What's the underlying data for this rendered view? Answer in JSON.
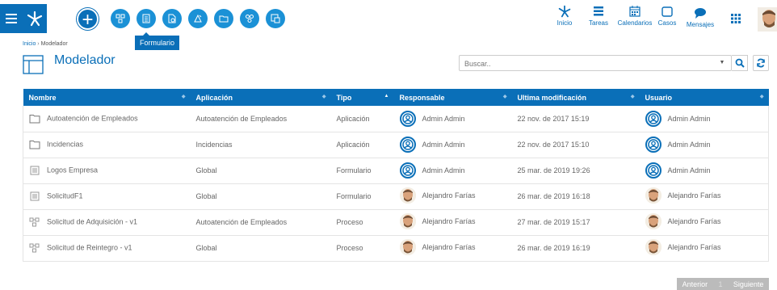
{
  "tooltip": "Formulario",
  "nav": [
    {
      "label": "Inicio",
      "icon": "home-logo-icon"
    },
    {
      "label": "Tareas",
      "icon": "tasks-icon"
    },
    {
      "label": "Calendarios",
      "icon": "calendar-icon"
    },
    {
      "label": "Casos",
      "icon": "cases-icon"
    },
    {
      "label": "Mensajes",
      "icon": "messages-icon"
    }
  ],
  "breadcrumb": {
    "home": "Inicio",
    "separator": "›",
    "current": "Modelador"
  },
  "page_title": "Modelador",
  "search": {
    "placeholder": "Buscar.."
  },
  "table": {
    "headers": [
      "Nombre",
      "Aplicación",
      "Tipo",
      "Responsable",
      "Ultima modificación",
      "Usuario"
    ],
    "rows": [
      {
        "icon": "folder-icon",
        "nombre": "Autoatención de Empleados",
        "aplicacion": "Autoatención de Empleados",
        "tipo": "Aplicación",
        "responsable": "Admin Admin",
        "resp_avatar": "admin",
        "modificacion": "22 nov. de 2017 15:19",
        "usuario": "Admin Admin",
        "user_avatar": "admin"
      },
      {
        "icon": "folder-icon",
        "nombre": "Incidencias",
        "aplicacion": "Incidencias",
        "tipo": "Aplicación",
        "responsable": "Admin Admin",
        "resp_avatar": "admin",
        "modificacion": "22 nov. de 2017 15:10",
        "usuario": "Admin Admin",
        "user_avatar": "admin"
      },
      {
        "icon": "form-icon",
        "nombre": "Logos Empresa",
        "aplicacion": "Global",
        "tipo": "Formulario",
        "responsable": "Admin Admin",
        "resp_avatar": "admin",
        "modificacion": "25 mar. de 2019 19:26",
        "usuario": "Admin Admin",
        "user_avatar": "admin"
      },
      {
        "icon": "form-icon",
        "nombre": "SolicitudF1",
        "aplicacion": "Global",
        "tipo": "Formulario",
        "responsable": "Alejandro Farías",
        "resp_avatar": "photo",
        "modificacion": "26 mar. de 2019 16:18",
        "usuario": "Alejandro Farías",
        "user_avatar": "photo"
      },
      {
        "icon": "process-icon",
        "nombre": "Solicitud de Adquisición - v1",
        "aplicacion": "Autoatención de Empleados",
        "tipo": "Proceso",
        "responsable": "Alejandro Farías",
        "resp_avatar": "photo",
        "modificacion": "27 mar. de 2019 15:17",
        "usuario": "Alejandro Farías",
        "user_avatar": "photo"
      },
      {
        "icon": "process-icon",
        "nombre": "Solicitud de Reintegro - v1",
        "aplicacion": "Global",
        "tipo": "Proceso",
        "responsable": "Alejandro Farías",
        "resp_avatar": "photo",
        "modificacion": "26 mar. de 2019 16:19",
        "usuario": "Alejandro Farías",
        "user_avatar": "photo"
      }
    ]
  },
  "pager": {
    "prev": "Anterior",
    "page": "1",
    "next": "Siguiente"
  },
  "colors": {
    "primary": "#0a6fb8",
    "object_button": "#1b91d6"
  }
}
